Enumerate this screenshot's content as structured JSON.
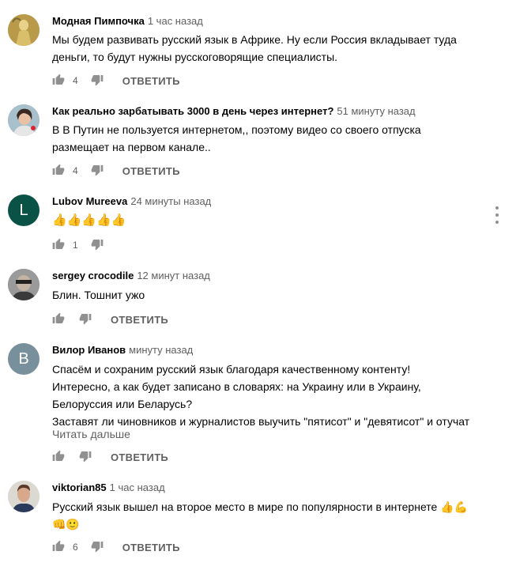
{
  "colors": {
    "text": "#030303",
    "secondary": "#606060",
    "icon": "#909090",
    "avatar_l": "#0a5246",
    "avatar_b": "#78909c"
  },
  "ui": {
    "reply_label": "ОТВЕТИТЬ",
    "read_more": "Читать дальше"
  },
  "comments": [
    {
      "author": "Модная Пимпочка",
      "time": "1 час назад",
      "avatar_icon": "gold-statue-avatar",
      "lines": [
        "Мы будем развивать русский язык в Африке. Ну если Россия вкладывает туда",
        "деньги, то будут нужны русскоговорящие специалисты."
      ],
      "likes": "4"
    },
    {
      "author": "Как реально зарбатывать 3000 в день через интернет?",
      "time": "51 минуту назад",
      "avatar_icon": "woman-photo-avatar",
      "lines": [
        "В  В Путин  не пользуется интернетом,, поэтому видео  со  своего  отпуска",
        "размещает на первом  канале.."
      ],
      "likes": "4"
    },
    {
      "author": "Lubov Mureeva",
      "time": "24 минуты назад",
      "avatar_letter": "L",
      "lines": [
        "👍👍👍👍👍"
      ],
      "likes": "1"
    },
    {
      "author": "sergey crocodile",
      "time": "12 минут назад",
      "avatar_icon": "man-photo-avatar",
      "lines": [
        "Блин.  Тошнит ужо"
      ],
      "likes": ""
    },
    {
      "author": "Вилор Иванов",
      "time": "минуту назад",
      "avatar_letter": "B",
      "lines": [
        "Спасём и сохраним русский язык благодаря качественному контенту!",
        "Интересно, а как будет записано в словарях: на Украину или в Украину,",
        "Белоруссия или Беларусь?",
        "Заставят ли чиновников и журналистов выучить \"пятисот\" и \"девятисот\" и отучат"
      ],
      "likes": ""
    },
    {
      "author": "viktorian85",
      "time": "1 час назад",
      "avatar_icon": "man-portrait-avatar",
      "lines": [
        "Русский язык вышел на второе место в мире по популярности в интернете 👍💪",
        "👊🙂"
      ],
      "likes": "6"
    }
  ]
}
